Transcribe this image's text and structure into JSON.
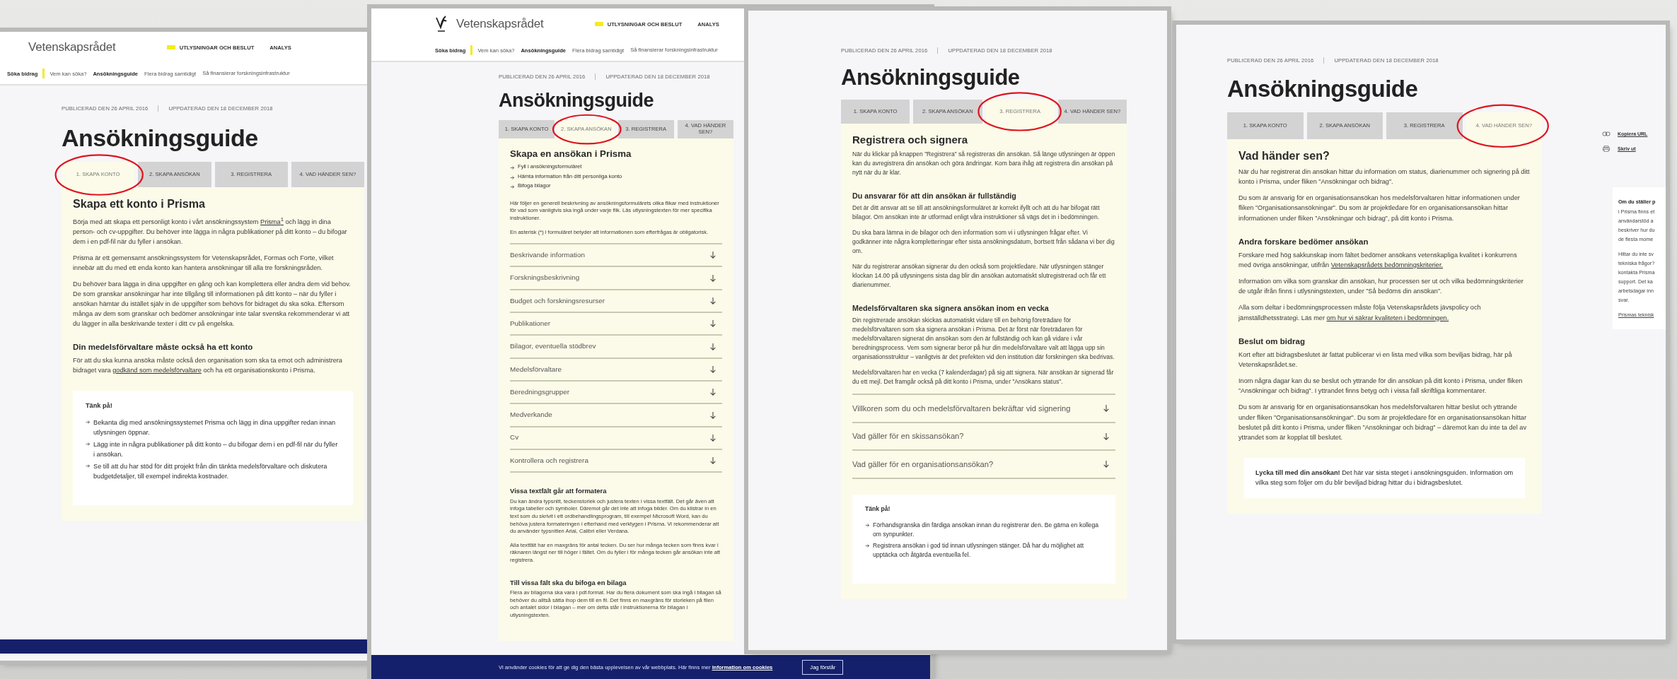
{
  "panels": [
    {
      "header": {
        "logo_icon": false,
        "logo": "Vetenskapsrådet",
        "top_links": [
          {
            "label": "UTLYSNINGAR OCH BESLUT",
            "selected": true
          },
          {
            "label": "ANALYS",
            "selected": false
          }
        ],
        "section_label": "Söka bidrag",
        "nav": [
          {
            "label": "Vem kan söka?",
            "selected": false
          },
          {
            "label": "Ansökningsguide",
            "selected": true
          },
          {
            "label": "Flera bidrag samtidigt",
            "selected": false
          },
          {
            "label": "Så finansierar forskningsinfrastruktur",
            "selected": false
          }
        ]
      },
      "meta": [
        "PUBLICERAD DEN 26 APRIL 2016",
        "UPPDATERAD DEN 18 DECEMBER 2018"
      ],
      "title": "Ansökningsguide",
      "highlight": true,
      "tabs": [
        {
          "label": "1. SKAPA KONTO",
          "selected": true
        },
        {
          "label": "2. SKAPA ANSÖKAN",
          "selected": false
        },
        {
          "label": "3. REGISTRERA",
          "selected": false
        },
        {
          "label": "4. VAD HÄNDER SEN?",
          "selected": false
        }
      ],
      "blocks": [
        {
          "kind": "heading",
          "text": "Skapa ett konto i Prisma"
        },
        {
          "kind": "paragraph",
          "runs": [
            {
              "kind": "text",
              "text": "Börja med att skapa ett personligt konto i vårt ansökningssystem "
            },
            {
              "kind": "link",
              "text": "Prisma$^{1}$"
            },
            {
              "kind": "text",
              "text": " och lägg in dina person- och cv-uppgifter. Du behöver inte lägga in några publikationer på ditt konto – du bifogar dem i en pdf-fil när du fyller i ansökan."
            }
          ]
        },
        {
          "kind": "paragraph",
          "runs": [
            {
              "kind": "text",
              "text": "Prisma är ett gemensamt ansökningssystem för Vetenskapsrådet, Formas och Forte, vilket innebär att du med ett enda konto kan hantera ansökningar till alla tre forskningsråden."
            }
          ]
        },
        {
          "kind": "paragraph",
          "runs": [
            {
              "kind": "text",
              "text": "Du behöver bara lägga in dina uppgifter en gång och kan komplettera eller ändra dem vid behov. De som granskar ansökningar har inte tillgång till informationen på ditt konto – när du fyller i ansökan hämtar du istället själv in de uppgifter som behövs för bidraget du ska söka. Eftersom många av dem som granskar och bedömer ansökningar inte talar svenska rekommenderar vi att du lägger in alla beskrivande texter i ditt cv på engelska."
            }
          ]
        },
        {
          "kind": "subheading",
          "text": "Din medelsförvaltare måste också ha ett konto"
        },
        {
          "kind": "paragraph",
          "runs": [
            {
              "kind": "text",
              "text": "För att du ska kunna ansöka måste också den organisation som ska ta emot och administrera bidraget vara "
            },
            {
              "kind": "link",
              "text": "godkänd som medelsförvaltare"
            },
            {
              "kind": "text",
              "text": " och ha ett organisationskonto i Prisma."
            }
          ]
        },
        {
          "kind": "tips",
          "title": "Tänk på!",
          "items": [
            "Bekanta dig med ansökningssystemet Prisma och lägg in dina uppgifter redan innan utlysningen öppnar.",
            "Lägg inte in några publikationer på ditt konto – du bifogar dem i en pdf-fil när du fyller i ansökan.",
            "Se till att du har stöd för ditt projekt från din tänkta medelsförvaltare och diskutera budgetdetaljer, till exempel indirekta kostnader."
          ]
        }
      ],
      "footer": {
        "kind": "bar"
      }
    },
    {
      "header": {
        "logo_icon": true,
        "logo": "Vetenskapsrådet",
        "top_links": [
          {
            "label": "UTLYSNINGAR OCH BESLUT",
            "selected": true
          },
          {
            "label": "ANALYS",
            "selected": false
          }
        ],
        "section_label": "Söka bidrag",
        "nav": [
          {
            "label": "Vem kan söka?",
            "selected": false
          },
          {
            "label": "Ansökningsguide",
            "selected": true
          },
          {
            "label": "Flera bidrag samtidigt",
            "selected": false
          },
          {
            "label": "Så finansierar forskningsinfrastruktur",
            "selected": false
          }
        ]
      },
      "meta": [
        "PUBLICERAD DEN 26 APRIL 2016",
        "UPPDATERAD DEN 18 DECEMBER 2018"
      ],
      "title": "Ansökningsguide",
      "highlight": true,
      "tabs": [
        {
          "label": "1. SKAPA KONTO",
          "selected": false
        },
        {
          "label": "2. SKAPA ANSÖKAN",
          "selected": true
        },
        {
          "label": "3. REGISTRERA",
          "selected": false
        },
        {
          "label": "4. VAD HÄNDER SEN?",
          "selected": false
        }
      ],
      "blocks": [
        {
          "kind": "heading",
          "text": "Skapa en ansökan i Prisma"
        },
        {
          "kind": "steps",
          "items": [
            "Fyll i ansökningsformuläret",
            "Hämta information från ditt personliga konto",
            "Bifoga bilagor"
          ]
        },
        {
          "kind": "paragraph",
          "runs": [
            {
              "kind": "text",
              "text": "Här följer en generell beskrivning av ansökningsformulärets olika flikar med instruktioner för vad som vanligtvis ska ingå under varje flik. Läs utlysningstexten för mer specifika instruktioner."
            }
          ]
        },
        {
          "kind": "paragraph",
          "runs": [
            {
              "kind": "text",
              "text": "En asterisk (*) i formuläret betyder att informationen som efterfrågas är obligatorisk."
            }
          ]
        },
        {
          "kind": "accordion",
          "items": [
            "Beskrivande information",
            "Forskningsbeskrivning",
            "Budget och forskningsresurser",
            "Publikationer",
            "Bilagor, eventuella stödbrev",
            "Medelsförvaltare",
            "Beredningsgrupper",
            "Medverkande",
            "Cv",
            "Kontrollera och registrera"
          ]
        },
        {
          "kind": "subheading",
          "text": "Vissa textfält går att formatera"
        },
        {
          "kind": "paragraph",
          "runs": [
            {
              "kind": "text",
              "text": "Du kan ändra typsnitt, teckenstorlek och justera texten i vissa textfält. Det går även att infoga tabeller och symboler. Däremot går det inte att infoga bilder. Om du klistrar in en text som du skrivit i ett ordbehandlingsprogram, till exempel Microsoft Word, kan du behöva justera formateringen i efterhand med verktygen i Prisma. Vi rekommenderar att du använder typsnitten Arial, Calibri eller Verdana."
            }
          ]
        },
        {
          "kind": "paragraph",
          "runs": [
            {
              "kind": "text",
              "text": "Alla textfält har en maxgräns för antal tecken. Du ser hur många tecken som finns kvar i räknaren längst ner till höger i fältet. Om du fyller i för många tecken går ansökan inte att registrera."
            }
          ]
        },
        {
          "kind": "subheading",
          "text": "Till vissa fält ska du bifoga en bilaga"
        },
        {
          "kind": "paragraph",
          "runs": [
            {
              "kind": "text",
              "text": "Flera av bilagorna ska vara i pdf-format. Har du flera dokument som ska ingå i bilagan så behöver du alltså sätta ihop dem till en fil. Det finns en maxgräns för storleken på filen och antalet sidor i bilagan – mer om detta står i instruktionerna för bilagan i utlysningstexten."
            }
          ]
        }
      ],
      "footer": {
        "kind": "cookie",
        "text": "Vi använder cookies för att ge dig den bästa upplevelsen av vår webbplats. Här finns mer ",
        "link": "information om cookies",
        "button": "Jag förstår"
      }
    },
    {
      "meta": [
        "PUBLICERAD DEN 26 APRIL 2016",
        "UPPDATERAD DEN 18 DECEMBER 2018"
      ],
      "title": "Ansökningsguide",
      "highlight": true,
      "tabs": [
        {
          "label": "1. SKAPA KONTO",
          "selected": false
        },
        {
          "label": "2. SKAPA ANSÖKAN",
          "selected": false
        },
        {
          "label": "3. REGISTRERA",
          "selected": true
        },
        {
          "label": "4. VAD HÄNDER SEN?",
          "selected": false
        }
      ],
      "blocks": [
        {
          "kind": "heading",
          "text": "Registrera och signera"
        },
        {
          "kind": "paragraph",
          "runs": [
            {
              "kind": "text",
              "text": "När du klickar på knappen ”Registrera” så registreras din ansökan. Så länge utlysningen är öppen kan du avregistrera din ansökan och göra ändringar. Kom bara ihåg att registrera din ansökan på nytt när du är klar."
            }
          ]
        },
        {
          "kind": "subheading",
          "text": "Du ansvarar för att din ansökan är fullständig"
        },
        {
          "kind": "paragraph",
          "runs": [
            {
              "kind": "text",
              "text": "Det är ditt ansvar att se till att ansökningsformuläret är korrekt ifyllt och att du har bifogat rätt bilagor. Om ansökan inte är utformad enligt våra instruktioner så vägs det in i bedömningen."
            }
          ]
        },
        {
          "kind": "paragraph",
          "runs": [
            {
              "kind": "text",
              "text": "Du ska bara lämna in de bilagor och den information som vi i utlysningen frågar efter. Vi godkänner inte några kompletteringar efter sista ansökningsdatum, bortsett från sådana vi ber dig om."
            }
          ]
        },
        {
          "kind": "paragraph",
          "runs": [
            {
              "kind": "text",
              "text": "När du registrerar ansökan signerar du den också som projektledare. När utlysningen stänger klockan 14.00 på utlysningens sista dag blir din ansökan automatiskt slutregistrerad och får ett diarienummer."
            }
          ]
        },
        {
          "kind": "subheading",
          "text": "Medelsförvaltaren ska signera ansökan inom en vecka"
        },
        {
          "kind": "paragraph",
          "runs": [
            {
              "kind": "text",
              "text": "Din registrerade ansökan skickas automatiskt vidare till en behörig företrädare för medelsförvaltaren som ska signera ansökan i Prisma. Det är först när företrädaren för medelsförvaltaren signerat din ansökan som den är fullständig och kan gå vidare i vår beredningsprocess. Vem som signerar beror på hur din medelsförvaltare valt att lägga upp sin organisationsstruktur – vanligtvis är det prefekten vid den institution där forskningen ska bedrivas."
            }
          ]
        },
        {
          "kind": "paragraph",
          "runs": [
            {
              "kind": "text",
              "text": "Medelsförvaltaren har en vecka (7 kalenderdagar) på sig att signera. När ansökan är signerad får du ett mejl. Det framgår också på ditt konto i Prisma, under ”Ansökans status”."
            }
          ]
        },
        {
          "kind": "accordion",
          "items": [
            "Villkoren som du och medelsförvaltaren bekräftar vid signering",
            "Vad gäller för en skissansökan?",
            "Vad gäller för en organisationsansökan?"
          ]
        },
        {
          "kind": "tips",
          "title": "Tänk på!",
          "items": [
            "Förhandsgranska din färdiga ansökan innan du registrerar den. Be gärna en kollega om synpunkter.",
            "Registrera ansökan i god tid innan utlysningen stänger. Då har du möjlighet att upptäcka och åtgärda eventuella fel."
          ]
        }
      ]
    },
    {
      "meta": [
        "PUBLICERAD DEN 26 APRIL 2016",
        "UPPDATERAD DEN 18 DECEMBER 2018"
      ],
      "title": "Ansökningsguide",
      "highlight": true,
      "tabs": [
        {
          "label": "1. SKAPA KONTO",
          "selected": false
        },
        {
          "label": "2. SKAPA ANSÖKAN",
          "selected": false
        },
        {
          "label": "3. REGISTRERA",
          "selected": false
        },
        {
          "label": "4. VAD HÄNDER SEN?",
          "selected": true
        }
      ],
      "blocks": [
        {
          "kind": "heading",
          "text": "Vad händer sen?"
        },
        {
          "kind": "paragraph",
          "runs": [
            {
              "kind": "text",
              "text": "När du har registrerat din ansökan hittar du information om status, diarienummer och signering på ditt konto i Prisma, under fliken ”Ansökningar och bidrag”."
            }
          ]
        },
        {
          "kind": "paragraph",
          "runs": [
            {
              "kind": "text",
              "text": "Du som är ansvarig för en organisationsansökan hos medelsförvaltaren hittar informationen under fliken ”Organisationsansökningar”. Du som är projektledare för en organisationsansökan hittar informationen under fliken ”Ansökningar och bidrag”, på ditt konto i Prisma."
            }
          ]
        },
        {
          "kind": "subheading",
          "text": "Andra forskare bedömer ansökan"
        },
        {
          "kind": "paragraph",
          "runs": [
            {
              "kind": "text",
              "text": "Forskare med hög sakkunskap inom fältet bedömer ansökans vetenskapliga kvalitet i konkurrens med övriga ansökningar, utifrån "
            },
            {
              "kind": "link",
              "text": "Vetenskapsrådets bedömningskriterier."
            }
          ]
        },
        {
          "kind": "paragraph",
          "runs": [
            {
              "kind": "text",
              "text": "Information om vilka som granskar din ansökan, hur processen ser ut och vilka bedömningskriterier de utgår ifrån finns i utlysningstexten, under ”Så bedöms din ansökan”."
            }
          ]
        },
        {
          "kind": "paragraph",
          "runs": [
            {
              "kind": "text",
              "text": "Alla som deltar i bedömningsprocessen måste följa Vetenskapsrådets jävspolicy och jämställdhetsstrategi. Läs mer "
            },
            {
              "kind": "link",
              "text": "om hur vi säkrar kvaliteten i bedömningen."
            }
          ]
        },
        {
          "kind": "subheading",
          "text": "Beslut om bidrag"
        },
        {
          "kind": "paragraph",
          "runs": [
            {
              "kind": "text",
              "text": "Kort efter att bidragsbeslutet är fattat publicerar vi en lista med vilka som beviljas bidrag, här på Vetenskapsrådet.se."
            }
          ]
        },
        {
          "kind": "paragraph",
          "runs": [
            {
              "kind": "text",
              "text": "Inom några dagar kan du se beslut och yttrande för din ansökan på ditt konto i Prisma, under fliken ”Ansökningar och bidrag”. I yttrandet finns betyg och i vissa fall skriftliga kommentarer."
            }
          ]
        },
        {
          "kind": "paragraph",
          "runs": [
            {
              "kind": "text",
              "text": "Du som är ansvarig för en organisationsansökan hos medelsförvaltaren hittar beslut och yttrande under fliken ”Organisationsansökningar”. Du som är projektledare för en organisationsansökan hittar beslutet på ditt konto i Prisma, under fliken ”Ansökningar och bidrag” – däremot kan du inte ta del av yttrandet som är kopplat till beslutet."
            }
          ]
        },
        {
          "kind": "note",
          "text": "**Lycka till med din ansökan!** Det här var sista steget i ansökningsguiden. Information om vilka steg som följer om du blir beviljad bidrag hittar du i bidragsbeslutet."
        }
      ],
      "side": {
        "links": [
          {
            "kind": "copy",
            "label": "Kopiera URL"
          },
          {
            "kind": "print",
            "label": "Skriv ut"
          }
        ],
        "box_lines": [
          {
            "kind": "bold",
            "text": "Om du ställer p"
          },
          {
            "kind": "text",
            "text": "i Prisma finns et"
          },
          {
            "kind": "text",
            "text": "användarstöd a"
          },
          {
            "kind": "text",
            "text": "beskriver hur du"
          },
          {
            "kind": "text",
            "text": "de flesta mome"
          },
          {
            "kind": "gap",
            "text": "Hittar du inte sv"
          },
          {
            "kind": "text",
            "text": "tekniska frågor?"
          },
          {
            "kind": "text",
            "text": "kontakta Prisma"
          },
          {
            "kind": "text",
            "text": "support. Det ka"
          },
          {
            "kind": "text",
            "text": "arbetsdagar inn"
          },
          {
            "kind": "text",
            "text": "svar."
          },
          {
            "kind": "link",
            "text": "Prismas teknisk"
          }
        ]
      }
    }
  ]
}
